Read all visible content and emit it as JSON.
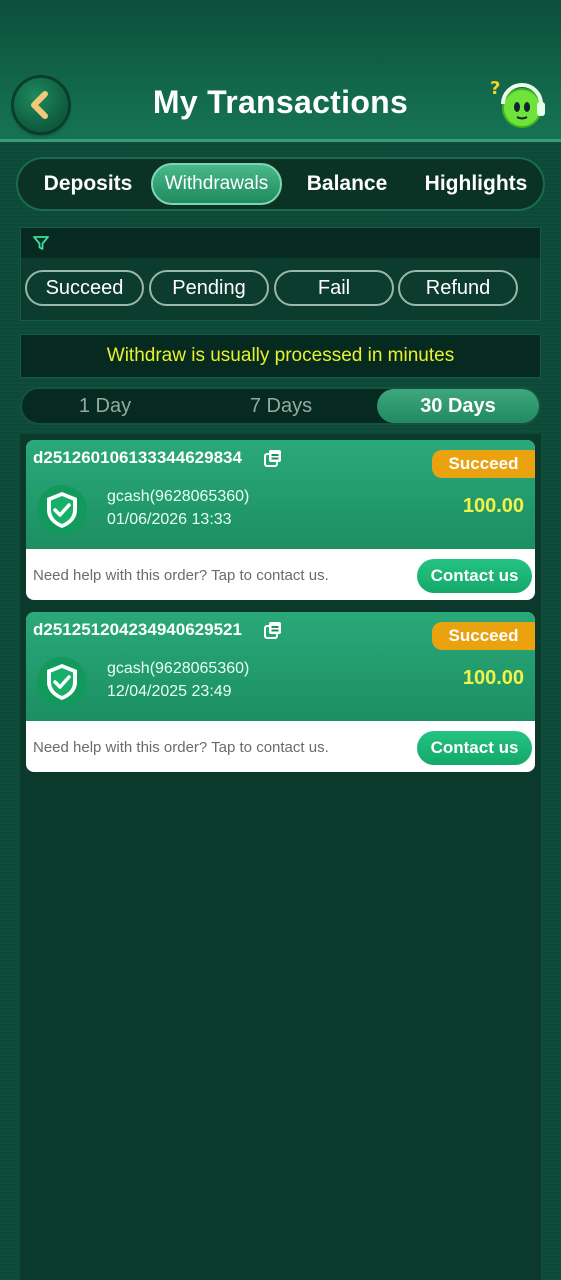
{
  "header": {
    "title": "My Transactions"
  },
  "tabs": [
    {
      "label": "Deposits"
    },
    {
      "label": "Withdrawals"
    },
    {
      "label": "Balance"
    },
    {
      "label": "Highlights"
    }
  ],
  "filters": [
    {
      "label": "Succeed"
    },
    {
      "label": "Pending"
    },
    {
      "label": "Fail"
    },
    {
      "label": "Refund"
    }
  ],
  "notice": "Withdraw is usually processed in minutes",
  "ranges": [
    {
      "label": "1 Day"
    },
    {
      "label": "7 Days"
    },
    {
      "label": "30 Days"
    }
  ],
  "transactions": [
    {
      "order_id": "d251260106133344629834",
      "status": "Succeed",
      "method": "gcash(9628065360)",
      "datetime": "01/06/2026 13:33",
      "amount": "100.00",
      "help": "Need help with this order? Tap to contact us.",
      "contact": "Contact us"
    },
    {
      "order_id": "d251251204234940629521",
      "status": "Succeed",
      "method": "gcash(9628065360)",
      "datetime": "12/04/2025 23:49",
      "amount": "100.00",
      "help": "Need help with this order? Tap to contact us.",
      "contact": "Contact us"
    }
  ],
  "colors": {
    "background": "#0d4a38",
    "accent": "#1f8a5f",
    "notice_text": "#e8f22a",
    "badge": "#eaa20f",
    "amount": "#f3f24a",
    "contact_button": "#14a869"
  }
}
